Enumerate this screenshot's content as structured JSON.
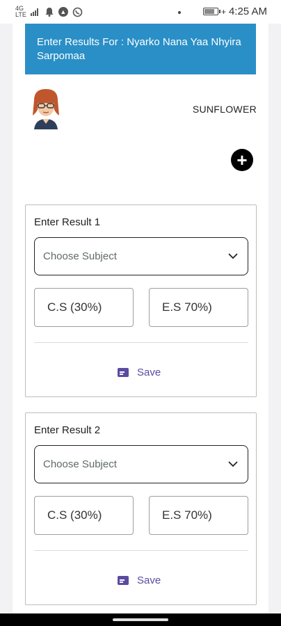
{
  "status_bar": {
    "signal_left": "4G",
    "signal_right": "LTE",
    "time": "4:25 AM"
  },
  "header": {
    "title": "Enter Results For : Nyarko Nana Yaa Nhyira Sarpomaa"
  },
  "school": {
    "name": "SUNFLOWER"
  },
  "add_button": {
    "icon": "plus-icon",
    "label": "+"
  },
  "cards": [
    {
      "title": "Enter Result 1",
      "subject_placeholder": "Choose Subject",
      "cs_label": "C.S (30%)",
      "es_label": "E.S 70%)",
      "save_label": "Save"
    },
    {
      "title": "Enter Result 2",
      "subject_placeholder": "Choose Subject",
      "cs_label": "C.S (30%)",
      "es_label": "E.S 70%)",
      "save_label": "Save"
    }
  ],
  "colors": {
    "banner": "#2a8fc6",
    "accent": "#5b4ba0"
  }
}
